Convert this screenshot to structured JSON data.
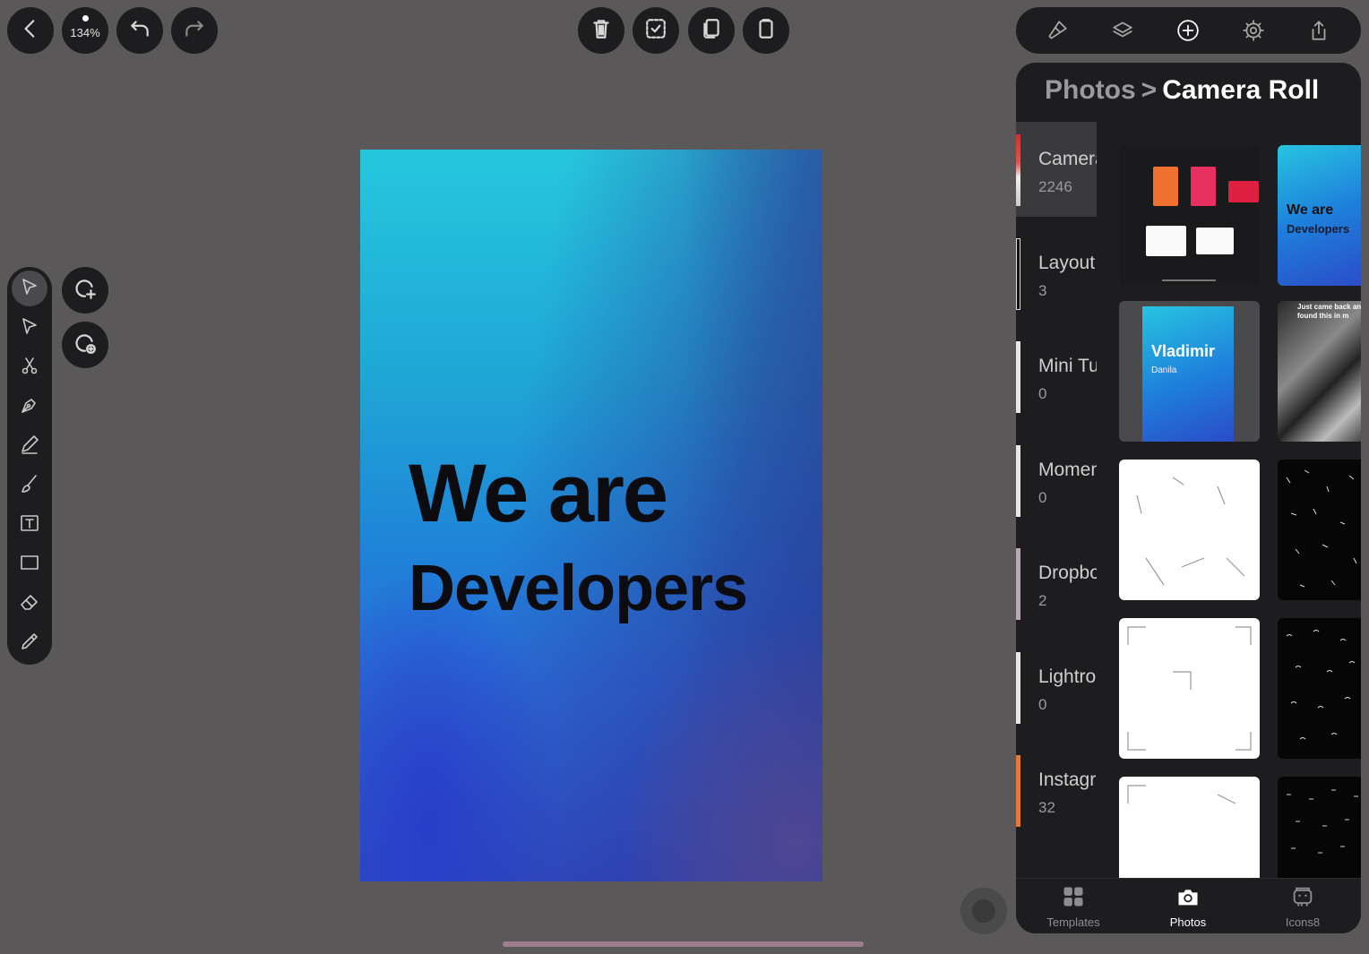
{
  "top_left": {
    "back_label": "back",
    "zoom_label": "134%"
  },
  "canvas": {
    "line1": "We are",
    "line2": "Developers"
  },
  "panel": {
    "breadcrumb_parent": "Photos",
    "breadcrumb_separator": ">",
    "breadcrumb_current": "Camera Roll",
    "albums": [
      {
        "name": "Camera Roll",
        "count": "2246",
        "selected": true
      },
      {
        "name": "Layout",
        "count": "3"
      },
      {
        "name": "Mini Tu",
        "count": "0"
      },
      {
        "name": "Moment",
        "count": "0"
      },
      {
        "name": "Dropbox",
        "count": "2"
      },
      {
        "name": "Lightroom",
        "count": "0"
      },
      {
        "name": "Instagram",
        "count": "32"
      }
    ],
    "thumbnails": {
      "poster_title_1": "We are",
      "poster_title_2": "Developers",
      "card_name": "Vladimir",
      "card_sub": "Danila",
      "tweet_text": "Just came back and found this in m"
    }
  },
  "tabs": [
    {
      "label": "Templates",
      "icon": "grid-icon"
    },
    {
      "label": "Photos",
      "icon": "camera-icon",
      "active": true
    },
    {
      "label": "Icons8",
      "icon": "icons8-icon"
    }
  ],
  "colors": {
    "toolbar_bg": "#1d1c1e",
    "workspace_bg": "#5a5858",
    "tab_active": "#ffffff",
    "tab_inactive": "#8e8e92"
  }
}
